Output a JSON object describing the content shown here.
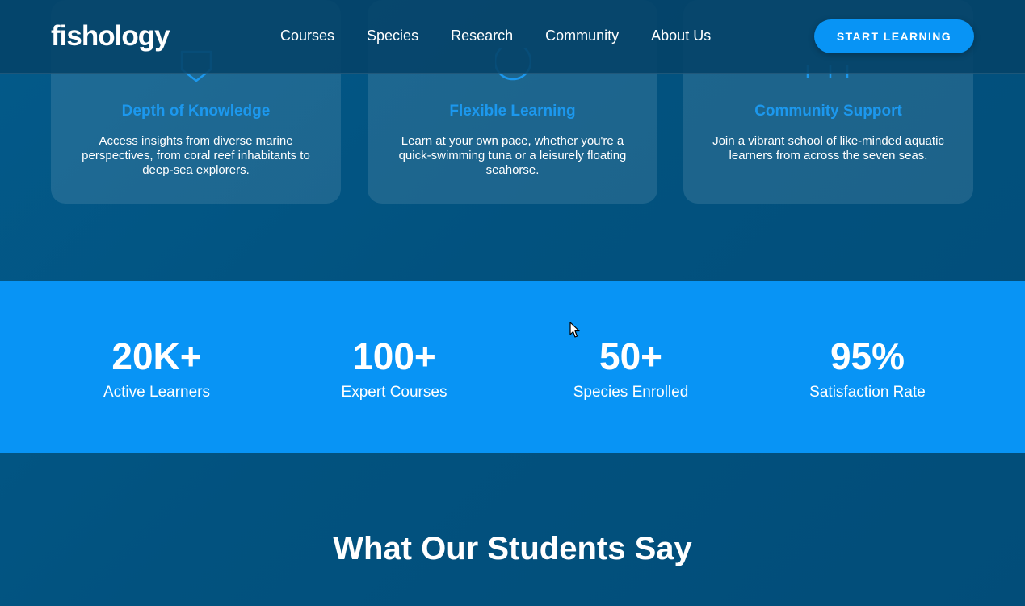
{
  "header": {
    "logo": "fishology",
    "nav": [
      "Courses",
      "Species",
      "Research",
      "Community",
      "About Us"
    ],
    "cta_label": "START LEARNING"
  },
  "features": [
    {
      "icon": "shield-icon",
      "title": "Depth of Knowledge",
      "description": "Access insights from diverse marine perspectives, from coral reef inhabitants to deep-sea explorers."
    },
    {
      "icon": "clock-icon",
      "title": "Flexible Learning",
      "description": "Learn at your own pace, whether you're a quick-swimming tuna or a leisurely floating seahorse."
    },
    {
      "icon": "users-icon",
      "title": "Community Support",
      "description": "Join a vibrant school of like-minded aquatic learners from across the seven seas."
    }
  ],
  "stats": [
    {
      "value": "20K+",
      "label": "Active Learners"
    },
    {
      "value": "100+",
      "label": "Expert Courses"
    },
    {
      "value": "50+",
      "label": "Species Enrolled"
    },
    {
      "value": "95%",
      "label": "Satisfaction Rate"
    }
  ],
  "testimonials": {
    "title": "What Our Students Say"
  },
  "colors": {
    "accent": "#0894f5",
    "background": "#02527f",
    "card_title": "#1c98ee"
  }
}
